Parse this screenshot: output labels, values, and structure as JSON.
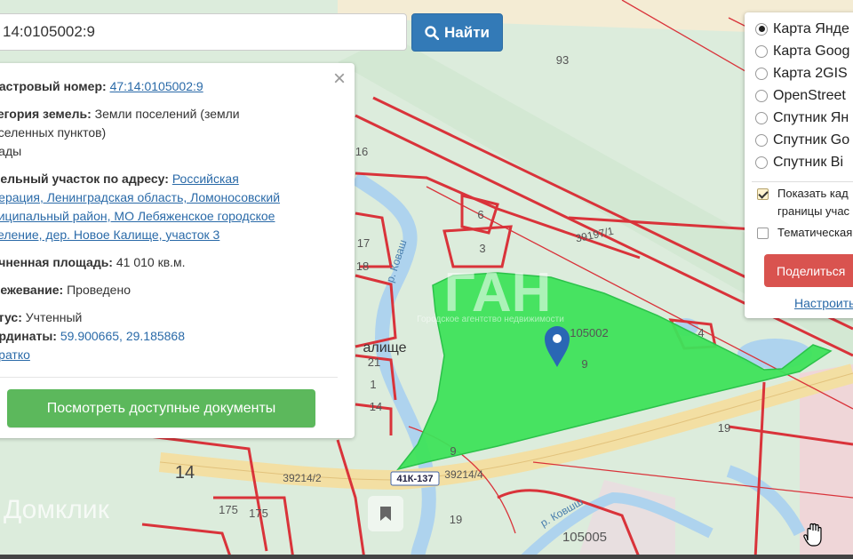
{
  "search": {
    "value": "14:0105002:9",
    "button_label": "Найти"
  },
  "info": {
    "cadastral_label": "дастровый номер:",
    "cadastral_value": "47:14:0105002:9",
    "category_label": "тегория земель:",
    "category_value_1": "Земли поселений (земли",
    "category_value_2": "оселенных пунктов)",
    "category_value_3": "лады",
    "address_label": "мельный участок по адресу:",
    "address_1": "Российская",
    "address_2": "дерация, Ленинградская область, Ломоносовский",
    "address_3": "ниципальный район, МО Лебяженское городское",
    "address_4": "селение, дер. Новое Калище, участок 3",
    "area_label": "очненная площадь:",
    "area_value": "41 010 кв.м.",
    "survey_label": "межевание:",
    "survey_value": "Проведено",
    "status_label": "атус:",
    "status_value": "Учтенный",
    "coords_label": "ординаты:",
    "coords_value": "59.900665, 29.185868",
    "brief_link": "Кратко",
    "docs_button": "Посмотреть доступные документы",
    "close": "×"
  },
  "layers": {
    "options": [
      {
        "label": "Карта Янде",
        "selected": true
      },
      {
        "label": "Карта Goog",
        "selected": false
      },
      {
        "label": "Карта 2GIS",
        "selected": false
      },
      {
        "label": "OpenStreet",
        "selected": false
      },
      {
        "label": "Спутник Ян",
        "selected": false
      },
      {
        "label": "Спутник Go",
        "selected": false
      },
      {
        "label": "Спутник Bi",
        "selected": false
      }
    ],
    "show_borders_1": "Показать кад",
    "show_borders_2": "границы учас",
    "thematic": "Тематическая",
    "share_button": "Поделиться",
    "configure_link": "Настроить"
  },
  "map": {
    "labels": {
      "n93": "93",
      "n16": "16",
      "n6": "6",
      "n3": "3",
      "n4": "4",
      "n17": "17",
      "n18": "18",
      "n21": "21",
      "n14a": "14",
      "n14b": "14",
      "n19a": "19",
      "n19b": "19",
      "n9a": "9",
      "n9b": "9",
      "n1": "1",
      "n175a": "175",
      "n175b": "175",
      "road1": "39197/1",
      "road2": "39214/2",
      "road3": "39214/4",
      "highway": "41К-137",
      "river1": "р. Коваш",
      "river2": "р. Ковшш",
      "village": "алище",
      "quarter1": "105002",
      "quarter2": "105005"
    },
    "watermark_1": "ГАН",
    "watermark_2": "Городское агентство недвижимости",
    "domclick": "Домклик",
    "colors": {
      "parcel": "#3ee35a",
      "boundary": "#d9333a",
      "water": "#aed3ee"
    }
  }
}
